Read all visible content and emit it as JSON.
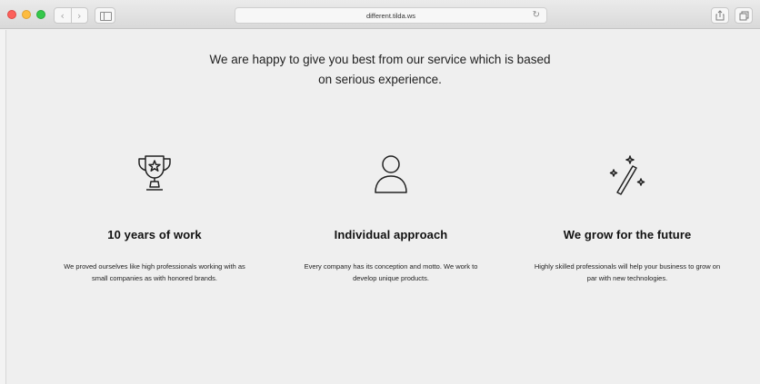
{
  "browser": {
    "url": "different.tilda.ws",
    "nav_back": "‹",
    "nav_forward": "›",
    "reload_symbol": "↻"
  },
  "page": {
    "intro_text": "We are happy to give you best from our service which is based on serious experience.",
    "features": [
      {
        "icon": "trophy-icon",
        "title": "10 years of work",
        "description": "We proved ourselves like high professionals working with as small companies as with honored brands."
      },
      {
        "icon": "user-icon",
        "title": "Individual approach",
        "description": "Every company has its conception and motto. We work to develop unique products."
      },
      {
        "icon": "magic-wand-icon",
        "title": "We grow for the future",
        "description": "Highly skilled professionals will help your business to grow on par with new technologies."
      }
    ]
  }
}
